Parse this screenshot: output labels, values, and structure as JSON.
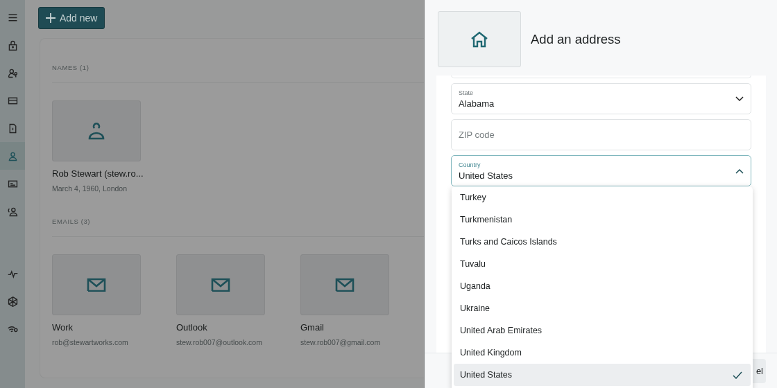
{
  "sidebar": {
    "items": [
      {
        "kind": "menu",
        "selected": false
      },
      {
        "kind": "lock",
        "selected": false
      },
      {
        "kind": "people",
        "selected": false
      },
      {
        "kind": "card",
        "selected": false
      },
      {
        "kind": "document",
        "selected": false
      },
      {
        "kind": "person",
        "selected": true
      },
      {
        "kind": "id",
        "selected": false
      },
      {
        "kind": "contact",
        "selected": false
      },
      {
        "kind": "gap",
        "selected": false
      },
      {
        "kind": "pulse",
        "selected": false
      },
      {
        "kind": "cube",
        "selected": false
      },
      {
        "kind": "wifi",
        "selected": false
      }
    ]
  },
  "add_button": {
    "label": "Add new"
  },
  "sections": [
    {
      "heading": "NAMES (1)",
      "kind": "person",
      "items": [
        {
          "title": "Rob Stewart (stew.ro...",
          "subtitle": "March 4, 1960, London"
        }
      ]
    },
    {
      "heading": "EMAILS (3)",
      "kind": "mail",
      "items": [
        {
          "title": "Work",
          "subtitle": "rob@stewartworks.com"
        },
        {
          "title": "Outlook",
          "subtitle": "stew.rob007@outlook.com"
        },
        {
          "title": "Gmail",
          "subtitle": "stew.rob007@gmail.com"
        }
      ]
    }
  ],
  "drawer": {
    "title": "Add an address",
    "fields": [
      {
        "kind": "cut"
      },
      {
        "kind": "select",
        "label": "State",
        "value": "Alabama",
        "expanded": false
      },
      {
        "kind": "text",
        "placeholder": "ZIP code"
      },
      {
        "kind": "select",
        "label": "Country",
        "value": "United States",
        "expanded": true
      }
    ],
    "options": [
      {
        "label": "Turkey",
        "selected": false
      },
      {
        "label": "Turkmenistan",
        "selected": false
      },
      {
        "label": "Turks and Caicos Islands",
        "selected": false
      },
      {
        "label": "Tuvalu",
        "selected": false
      },
      {
        "label": "Uganda",
        "selected": false
      },
      {
        "label": "Ukraine",
        "selected": false
      },
      {
        "label": "United Arab Emirates",
        "selected": false
      },
      {
        "label": "United Kingdom",
        "selected": false
      },
      {
        "label": "United States",
        "selected": true
      }
    ],
    "footer_button": {
      "label": "el"
    }
  }
}
